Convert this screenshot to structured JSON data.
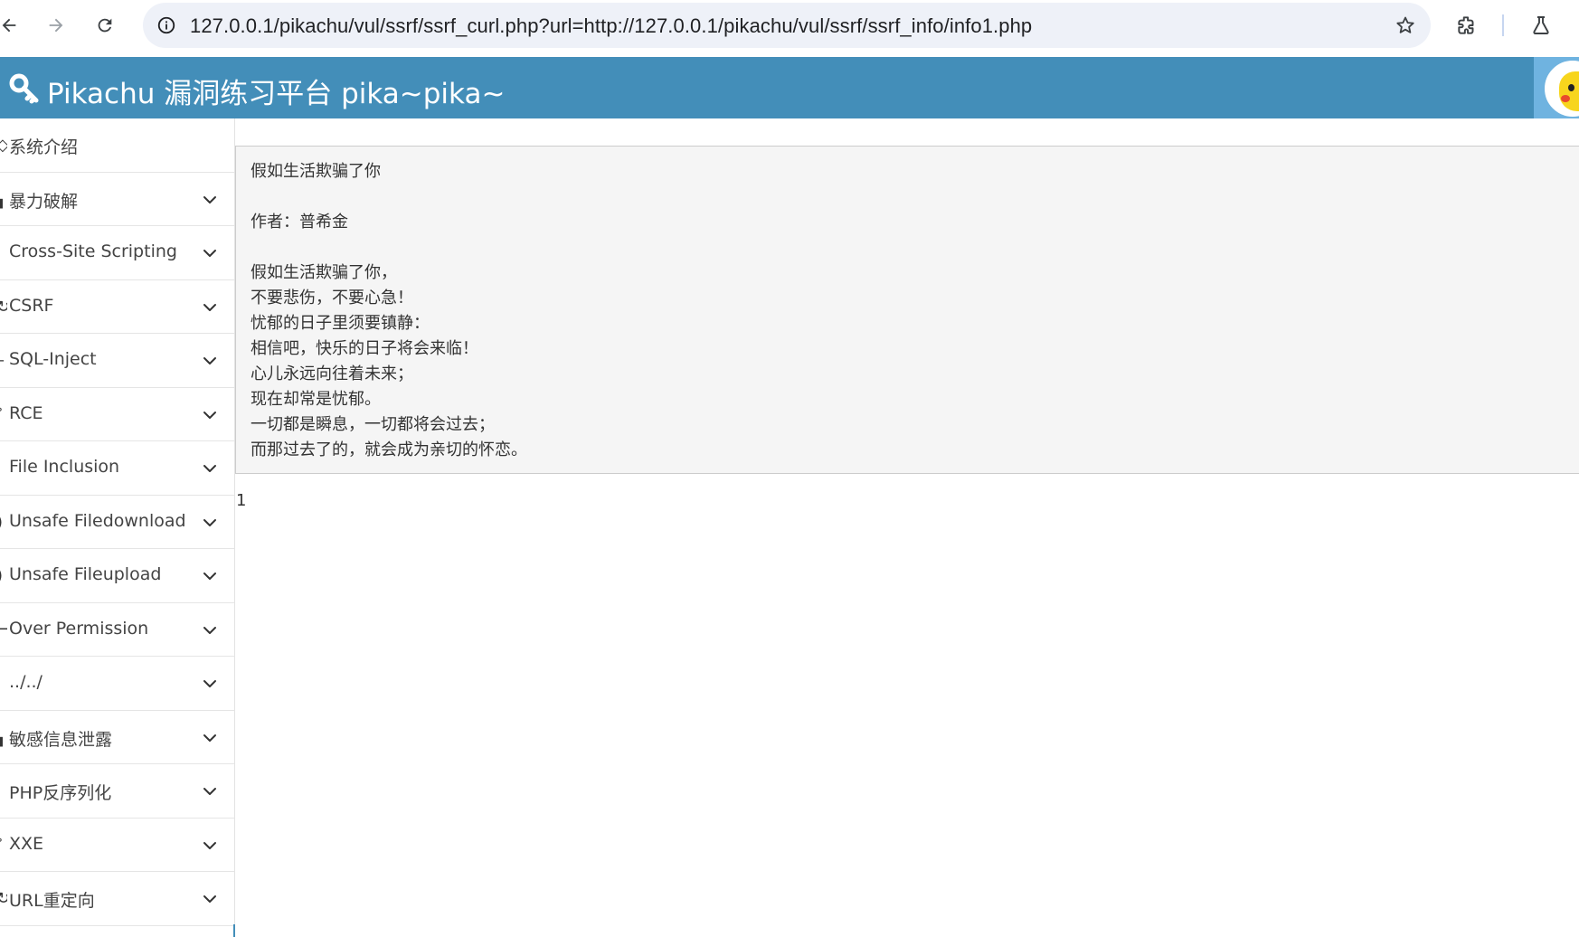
{
  "browser": {
    "url": "127.0.0.1/pikachu/vul/ssrf/ssrf_curl.php?url=http://127.0.0.1/pikachu/vul/ssrf/ssrf_info/info1.php",
    "icons": [
      "back-arrow-icon",
      "forward-arrow-icon",
      "reload-icon",
      "info-icon",
      "star-icon",
      "extensions-icon",
      "labs-flask-icon"
    ]
  },
  "header": {
    "title": "Pikachu 漏洞练习平台 pika~pika~",
    "color": "#438eb9"
  },
  "sidebar": {
    "items": [
      {
        "label": "系统介绍",
        "icon": "◇",
        "has_chevron": false
      },
      {
        "label": "暴力破解",
        "icon": "▖",
        "has_chevron": true
      },
      {
        "label": "Cross-Site Scripting",
        "icon": "⁚",
        "has_chevron": true
      },
      {
        "label": "CSRF",
        "icon": "↻",
        "has_chevron": true
      },
      {
        "label": "SQL-Inject",
        "icon": "–",
        "has_chevron": true
      },
      {
        "label": "RCE",
        "icon": "ˀ",
        "has_chevron": true
      },
      {
        "label": "File Inclusion",
        "icon": "▏",
        "has_chevron": true
      },
      {
        "label": "Unsafe Filedownload",
        "icon": ")",
        "has_chevron": true
      },
      {
        "label": "Unsafe Fileupload",
        "icon": ")",
        "has_chevron": true
      },
      {
        "label": "Over Permission",
        "icon": "⌐",
        "has_chevron": true
      },
      {
        "label": "../../",
        "icon": "⁚",
        "has_chevron": true
      },
      {
        "label": "敏感信息泄露",
        "icon": "▖",
        "has_chevron": true
      },
      {
        "label": "PHP反序列化",
        "icon": "⁚",
        "has_chevron": true
      },
      {
        "label": "XXE",
        "icon": "ˀ",
        "has_chevron": true
      },
      {
        "label": "URL重定向",
        "icon": "↻",
        "has_chevron": true
      }
    ]
  },
  "content": {
    "title_line": "假如生活欺骗了你",
    "author_line": "作者：普希金",
    "poem_lines": [
      "假如生活欺骗了你，",
      "不要悲伤，不要心急！",
      "忧郁的日子里须要镇静：",
      "相信吧，快乐的日子将会来临！",
      "心儿永远向往着未来；",
      "现在却常是忧郁。",
      "一切都是瞬息，一切都将会过去；",
      "而那过去了的，就会成为亲切的怀恋。"
    ],
    "page_number": "1"
  }
}
